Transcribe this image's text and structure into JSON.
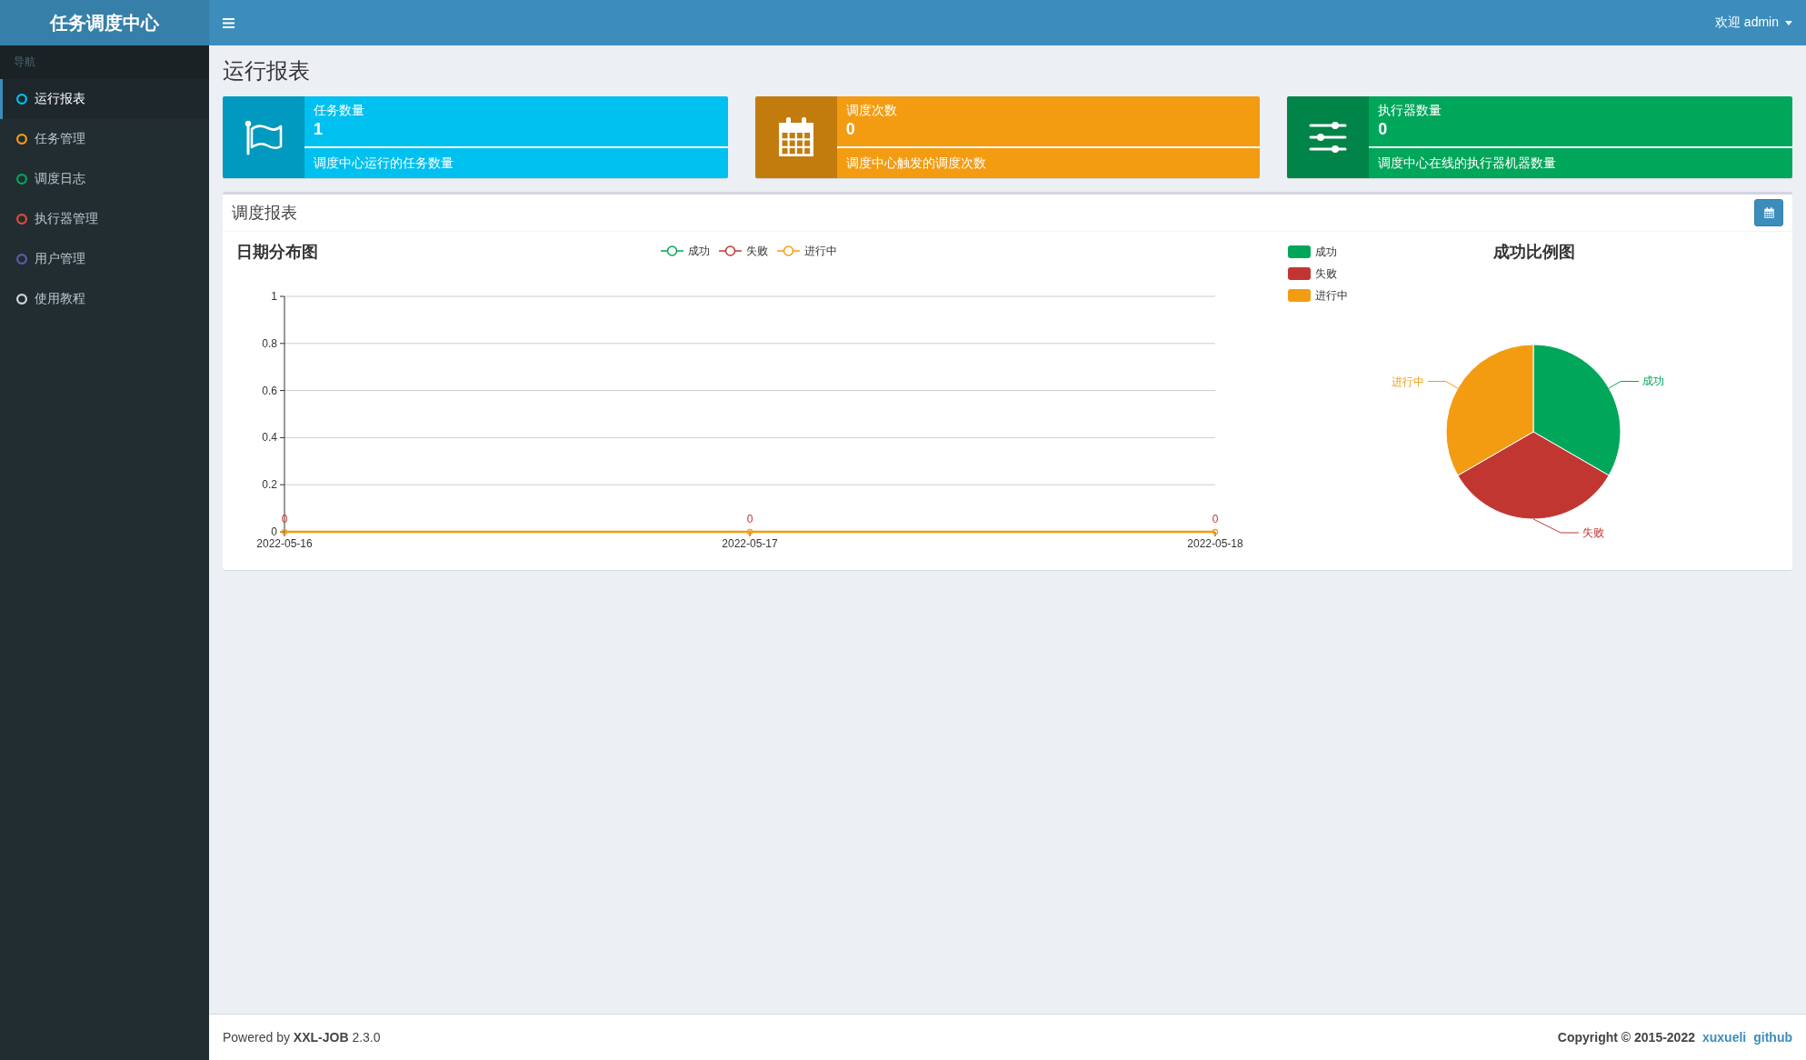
{
  "header": {
    "logo": "任务调度中心",
    "user_menu": "欢迎 admin"
  },
  "sidebar": {
    "heading": "导航",
    "items": [
      {
        "label": "运行报表",
        "color": "#00c0ef",
        "selected": true
      },
      {
        "label": "任务管理",
        "color": "#f39c12",
        "selected": false
      },
      {
        "label": "调度日志",
        "color": "#00a65a",
        "selected": false
      },
      {
        "label": "执行器管理",
        "color": "#dd4b39",
        "selected": false
      },
      {
        "label": "用户管理",
        "color": "#605ca8",
        "selected": false
      },
      {
        "label": "使用教程",
        "color": "#d2d6de",
        "selected": false
      }
    ]
  },
  "page_title": "运行报表",
  "info_boxes": [
    {
      "label": "任务数量",
      "value": "1",
      "level": 1,
      "description": "调度中心运行的任务数量",
      "color": "#00c0ef"
    },
    {
      "label": "调度次数",
      "value": "0",
      "level": 1,
      "description": "调度中心触发的调度次数",
      "color": "#f39c12"
    },
    {
      "label": "执行器数量",
      "value": "0",
      "level": 1,
      "description": "调度中心在线的执行器机器数量",
      "color": "#00a65a"
    }
  ],
  "report": {
    "title": "调度报表",
    "date_chart": {
      "chart_data": [
        {
          "type": "line",
          "title": "日期分布图",
          "categories": [
            "2022-05-16",
            "2022-05-17",
            "2022-05-18"
          ],
          "series": [
            {
              "name": "成功",
              "color": "#00a65a",
              "values": [
                null,
                null,
                null
              ]
            },
            {
              "name": "失败",
              "color": "#c23632",
              "values": [
                null,
                null,
                null
              ],
              "value_labels": [
                "0",
                "0",
                "0"
              ]
            },
            {
              "name": "进行中",
              "color": "#f39c12",
              "values": [
                0,
                0,
                0
              ]
            }
          ],
          "ylim": [
            0,
            1
          ],
          "yticks": [
            0,
            0.2,
            0.4,
            0.6,
            0.8,
            1
          ],
          "legend": "top",
          "marker": "circle",
          "grid": true
        }
      ]
    },
    "ratio_chart": {
      "chart_data": [
        {
          "type": "pie",
          "title": "成功比例图",
          "categories": [
            "成功",
            "失败",
            "进行中"
          ],
          "values": [
            33.33,
            33.33,
            33.34
          ],
          "colors": [
            "#00a65a",
            "#c23632",
            "#f39c12"
          ],
          "legend": "top-left"
        }
      ]
    }
  },
  "footer": {
    "powered_by": "Powered by **XXL-JOB** 2.3.0",
    "copyright": "Copyright © 2015-2022",
    "links": [
      "xuxueli",
      "github"
    ]
  }
}
